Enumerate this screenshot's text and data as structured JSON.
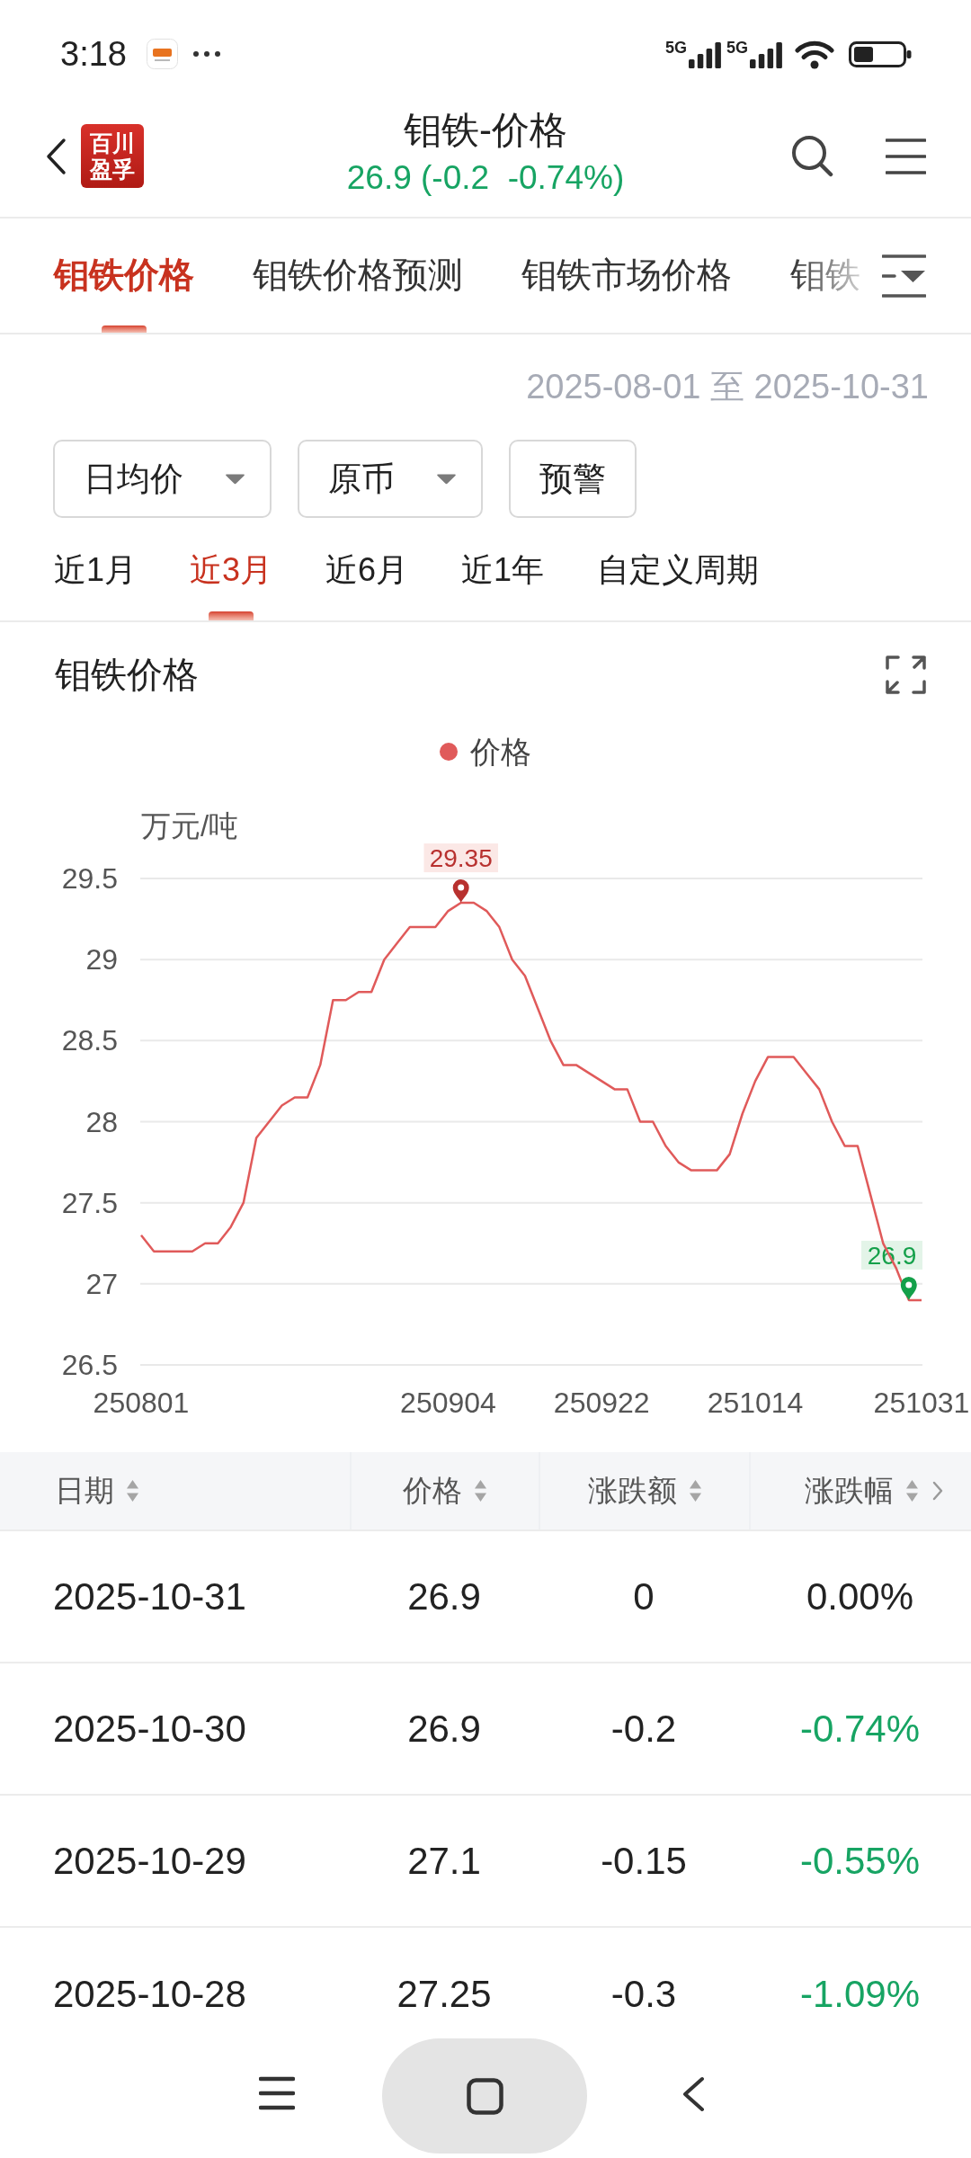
{
  "status_bar": {
    "time": "3:18",
    "networks": [
      "5G",
      "5G"
    ]
  },
  "header": {
    "logo_lines": [
      "百川",
      "盈孚"
    ],
    "title": "钼铁-价格",
    "quote": "26.9 (-0.2  -0.74%)"
  },
  "tabs": [
    {
      "label": "钼铁价格",
      "selected": true
    },
    {
      "label": "钼铁价格预测",
      "selected": false
    },
    {
      "label": "钼铁市场价格",
      "selected": false
    },
    {
      "label": "钼铁",
      "selected": false
    }
  ],
  "date_range": "2025-08-01 至 2025-10-31",
  "filters": [
    {
      "label": "日均价",
      "kind": "dropdown"
    },
    {
      "label": "原币",
      "kind": "dropdown"
    },
    {
      "label": "预警",
      "kind": "button"
    }
  ],
  "periods": [
    {
      "label": "近1月",
      "selected": false
    },
    {
      "label": "近3月",
      "selected": true
    },
    {
      "label": "近6月",
      "selected": false
    },
    {
      "label": "近1年",
      "selected": false
    },
    {
      "label": "自定义周期",
      "selected": false
    }
  ],
  "chart": {
    "chart_data": {
      "type": "line",
      "title": "钼铁价格",
      "ylabel": "万元/吨",
      "categories": [
        "250801",
        null,
        null,
        null,
        null,
        null,
        null,
        null,
        null,
        null,
        null,
        null,
        null,
        null,
        null,
        null,
        null,
        null,
        null,
        null,
        null,
        null,
        null,
        null,
        "250904",
        null,
        null,
        null,
        null,
        null,
        null,
        null,
        null,
        null,
        null,
        null,
        "250922",
        null,
        null,
        null,
        null,
        null,
        null,
        null,
        null,
        null,
        null,
        null,
        "251014",
        null,
        null,
        null,
        null,
        null,
        null,
        null,
        null,
        null,
        null,
        null,
        null,
        "251031"
      ],
      "series": [
        {
          "name": "价格",
          "color": "#e05a5a",
          "values": [
            27.3,
            27.2,
            27.2,
            27.2,
            27.2,
            27.25,
            27.25,
            27.35,
            27.5,
            27.9,
            28,
            28.1,
            28.15,
            28.15,
            28.35,
            28.75,
            28.75,
            28.8,
            28.8,
            29,
            29.1,
            29.2,
            29.2,
            29.2,
            29.3,
            29.35,
            29.35,
            29.3,
            29.2,
            29,
            28.9,
            28.7,
            28.5,
            28.35,
            28.35,
            28.3,
            28.25,
            28.2,
            28.2,
            28,
            28,
            27.85,
            27.75,
            27.7,
            27.7,
            27.7,
            27.8,
            28.05,
            28.25,
            28.4,
            28.4,
            28.4,
            28.3,
            28.2,
            28,
            27.85,
            27.85,
            27.55,
            27.25,
            27.1,
            26.9,
            26.9
          ]
        }
      ],
      "ylim": [
        26.5,
        29.5
      ],
      "yticks": [
        26.5,
        27,
        27.5,
        28,
        28.5,
        29,
        29.5
      ],
      "grid": true,
      "annotations": [
        "29.35",
        "26.9"
      ]
    }
  },
  "table": {
    "columns": [
      "日期",
      "价格",
      "涨跌额",
      "涨跌幅"
    ],
    "rows": [
      {
        "date": "2025-10-31",
        "price": "26.9",
        "change": "0",
        "change_pct": "0.00%",
        "color": "#222222"
      },
      {
        "date": "2025-10-30",
        "price": "26.9",
        "change": "-0.2",
        "change_pct": "-0.74%",
        "color": "#17a463"
      },
      {
        "date": "2025-10-29",
        "price": "27.1",
        "change": "-0.15",
        "change_pct": "-0.55%",
        "color": "#17a463"
      },
      {
        "date": "2025-10-28",
        "price": "27.25",
        "change": "-0.3",
        "change_pct": "-1.09%",
        "color": "#17a463"
      }
    ]
  }
}
